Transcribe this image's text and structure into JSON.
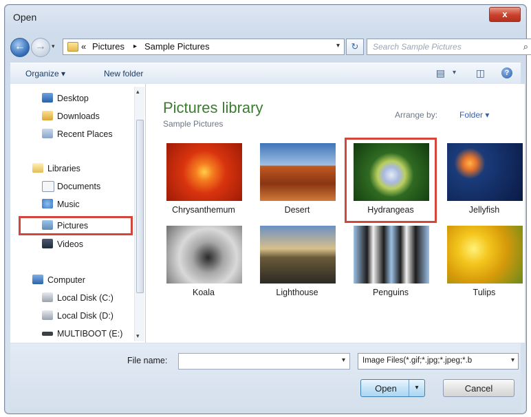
{
  "window": {
    "title": "Open",
    "close_label": "x"
  },
  "address": {
    "back_glyph": "←",
    "forward_glyph": "→",
    "overflow": "«",
    "crumbs": [
      "Pictures",
      "Sample Pictures"
    ],
    "separator": "▸",
    "refresh_glyph": "↻",
    "search_placeholder": "Search Sample Pictures"
  },
  "toolbar": {
    "organize": "Organize ▾",
    "new_folder": "New folder",
    "views_drop": "▾"
  },
  "sidebar": {
    "items": [
      {
        "label": "Desktop",
        "icon": "desktop-icon"
      },
      {
        "label": "Downloads",
        "icon": "downloads-icon"
      },
      {
        "label": "Recent Places",
        "icon": "recent-places-icon"
      },
      {
        "label": "Libraries",
        "icon": "libraries-icon"
      },
      {
        "label": "Documents",
        "icon": "documents-icon"
      },
      {
        "label": "Music",
        "icon": "music-icon"
      },
      {
        "label": "Pictures",
        "icon": "pictures-icon",
        "selected": true
      },
      {
        "label": "Videos",
        "icon": "videos-icon"
      },
      {
        "label": "Computer",
        "icon": "computer-icon"
      },
      {
        "label": "Local Disk (C:)",
        "icon": "drive-icon"
      },
      {
        "label": "Local Disk (D:)",
        "icon": "drive-icon"
      },
      {
        "label": "MULTIBOOT (E:)",
        "icon": "usb-drive-icon"
      }
    ]
  },
  "library": {
    "title": "Pictures library",
    "subtitle": "Sample Pictures",
    "arrange_label": "Arrange by:",
    "arrange_value": "Folder ▾"
  },
  "files": [
    {
      "name": "Chrysanthemum"
    },
    {
      "name": "Desert"
    },
    {
      "name": "Hydrangeas",
      "highlighted": true
    },
    {
      "name": "Jellyfish"
    },
    {
      "name": "Koala"
    },
    {
      "name": "Lighthouse"
    },
    {
      "name": "Penguins"
    },
    {
      "name": "Tulips"
    }
  ],
  "footer": {
    "file_name_label": "File name:",
    "file_name_value": "",
    "filter_value": "Image Files(*.gif;*.jpg;*.jpeg;*.b",
    "open_label": "Open",
    "cancel_label": "Cancel"
  },
  "colors": {
    "library_title": "#3b7d2e",
    "highlight_box": "#d4463a",
    "link_blue": "#2e62b2"
  }
}
